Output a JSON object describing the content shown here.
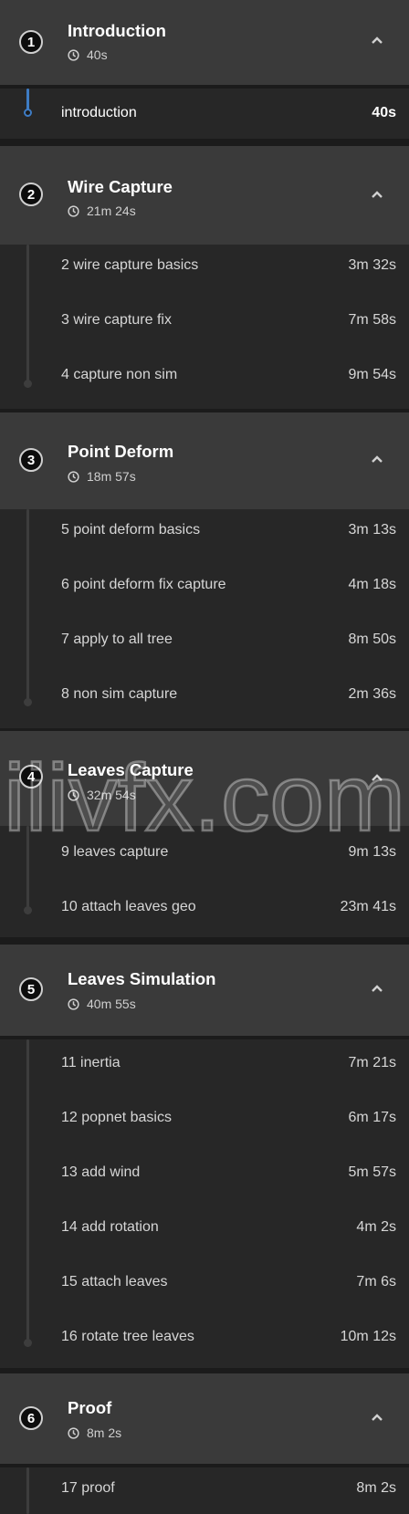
{
  "watermark": "iiivfx.com",
  "sections": [
    {
      "number": "1",
      "title": "Introduction",
      "duration": "40s",
      "items": [
        {
          "label": "introduction",
          "duration": "40s"
        }
      ]
    },
    {
      "number": "2",
      "title": "Wire Capture",
      "duration": "21m 24s",
      "items": [
        {
          "label": "2 wire capture basics",
          "duration": "3m 32s"
        },
        {
          "label": "3 wire capture fix",
          "duration": "7m 58s"
        },
        {
          "label": "4 capture non sim",
          "duration": "9m 54s"
        }
      ]
    },
    {
      "number": "3",
      "title": "Point Deform",
      "duration": "18m 57s",
      "items": [
        {
          "label": "5 point deform basics",
          "duration": "3m 13s"
        },
        {
          "label": "6 point deform fix capture",
          "duration": "4m 18s"
        },
        {
          "label": "7 apply to all tree",
          "duration": "8m 50s"
        },
        {
          "label": "8 non sim capture",
          "duration": "2m 36s"
        }
      ]
    },
    {
      "number": "4",
      "title": "Leaves Capture",
      "duration": "32m 54s",
      "items": [
        {
          "label": "9 leaves capture",
          "duration": "9m 13s"
        },
        {
          "label": "10 attach leaves geo",
          "duration": "23m 41s"
        }
      ]
    },
    {
      "number": "5",
      "title": "Leaves Simulation",
      "duration": "40m 55s",
      "items": [
        {
          "label": "11 inertia",
          "duration": "7m 21s"
        },
        {
          "label": "12 popnet basics",
          "duration": "6m 17s"
        },
        {
          "label": "13 add wind",
          "duration": "5m 57s"
        },
        {
          "label": "14 add rotation",
          "duration": "4m 2s"
        },
        {
          "label": "15 attach leaves",
          "duration": "7m 6s"
        },
        {
          "label": "16 rotate tree leaves",
          "duration": "10m 12s"
        }
      ]
    },
    {
      "number": "6",
      "title": "Proof",
      "duration": "8m 2s",
      "items": [
        {
          "label": "17 proof",
          "duration": "8m 2s"
        }
      ]
    }
  ]
}
